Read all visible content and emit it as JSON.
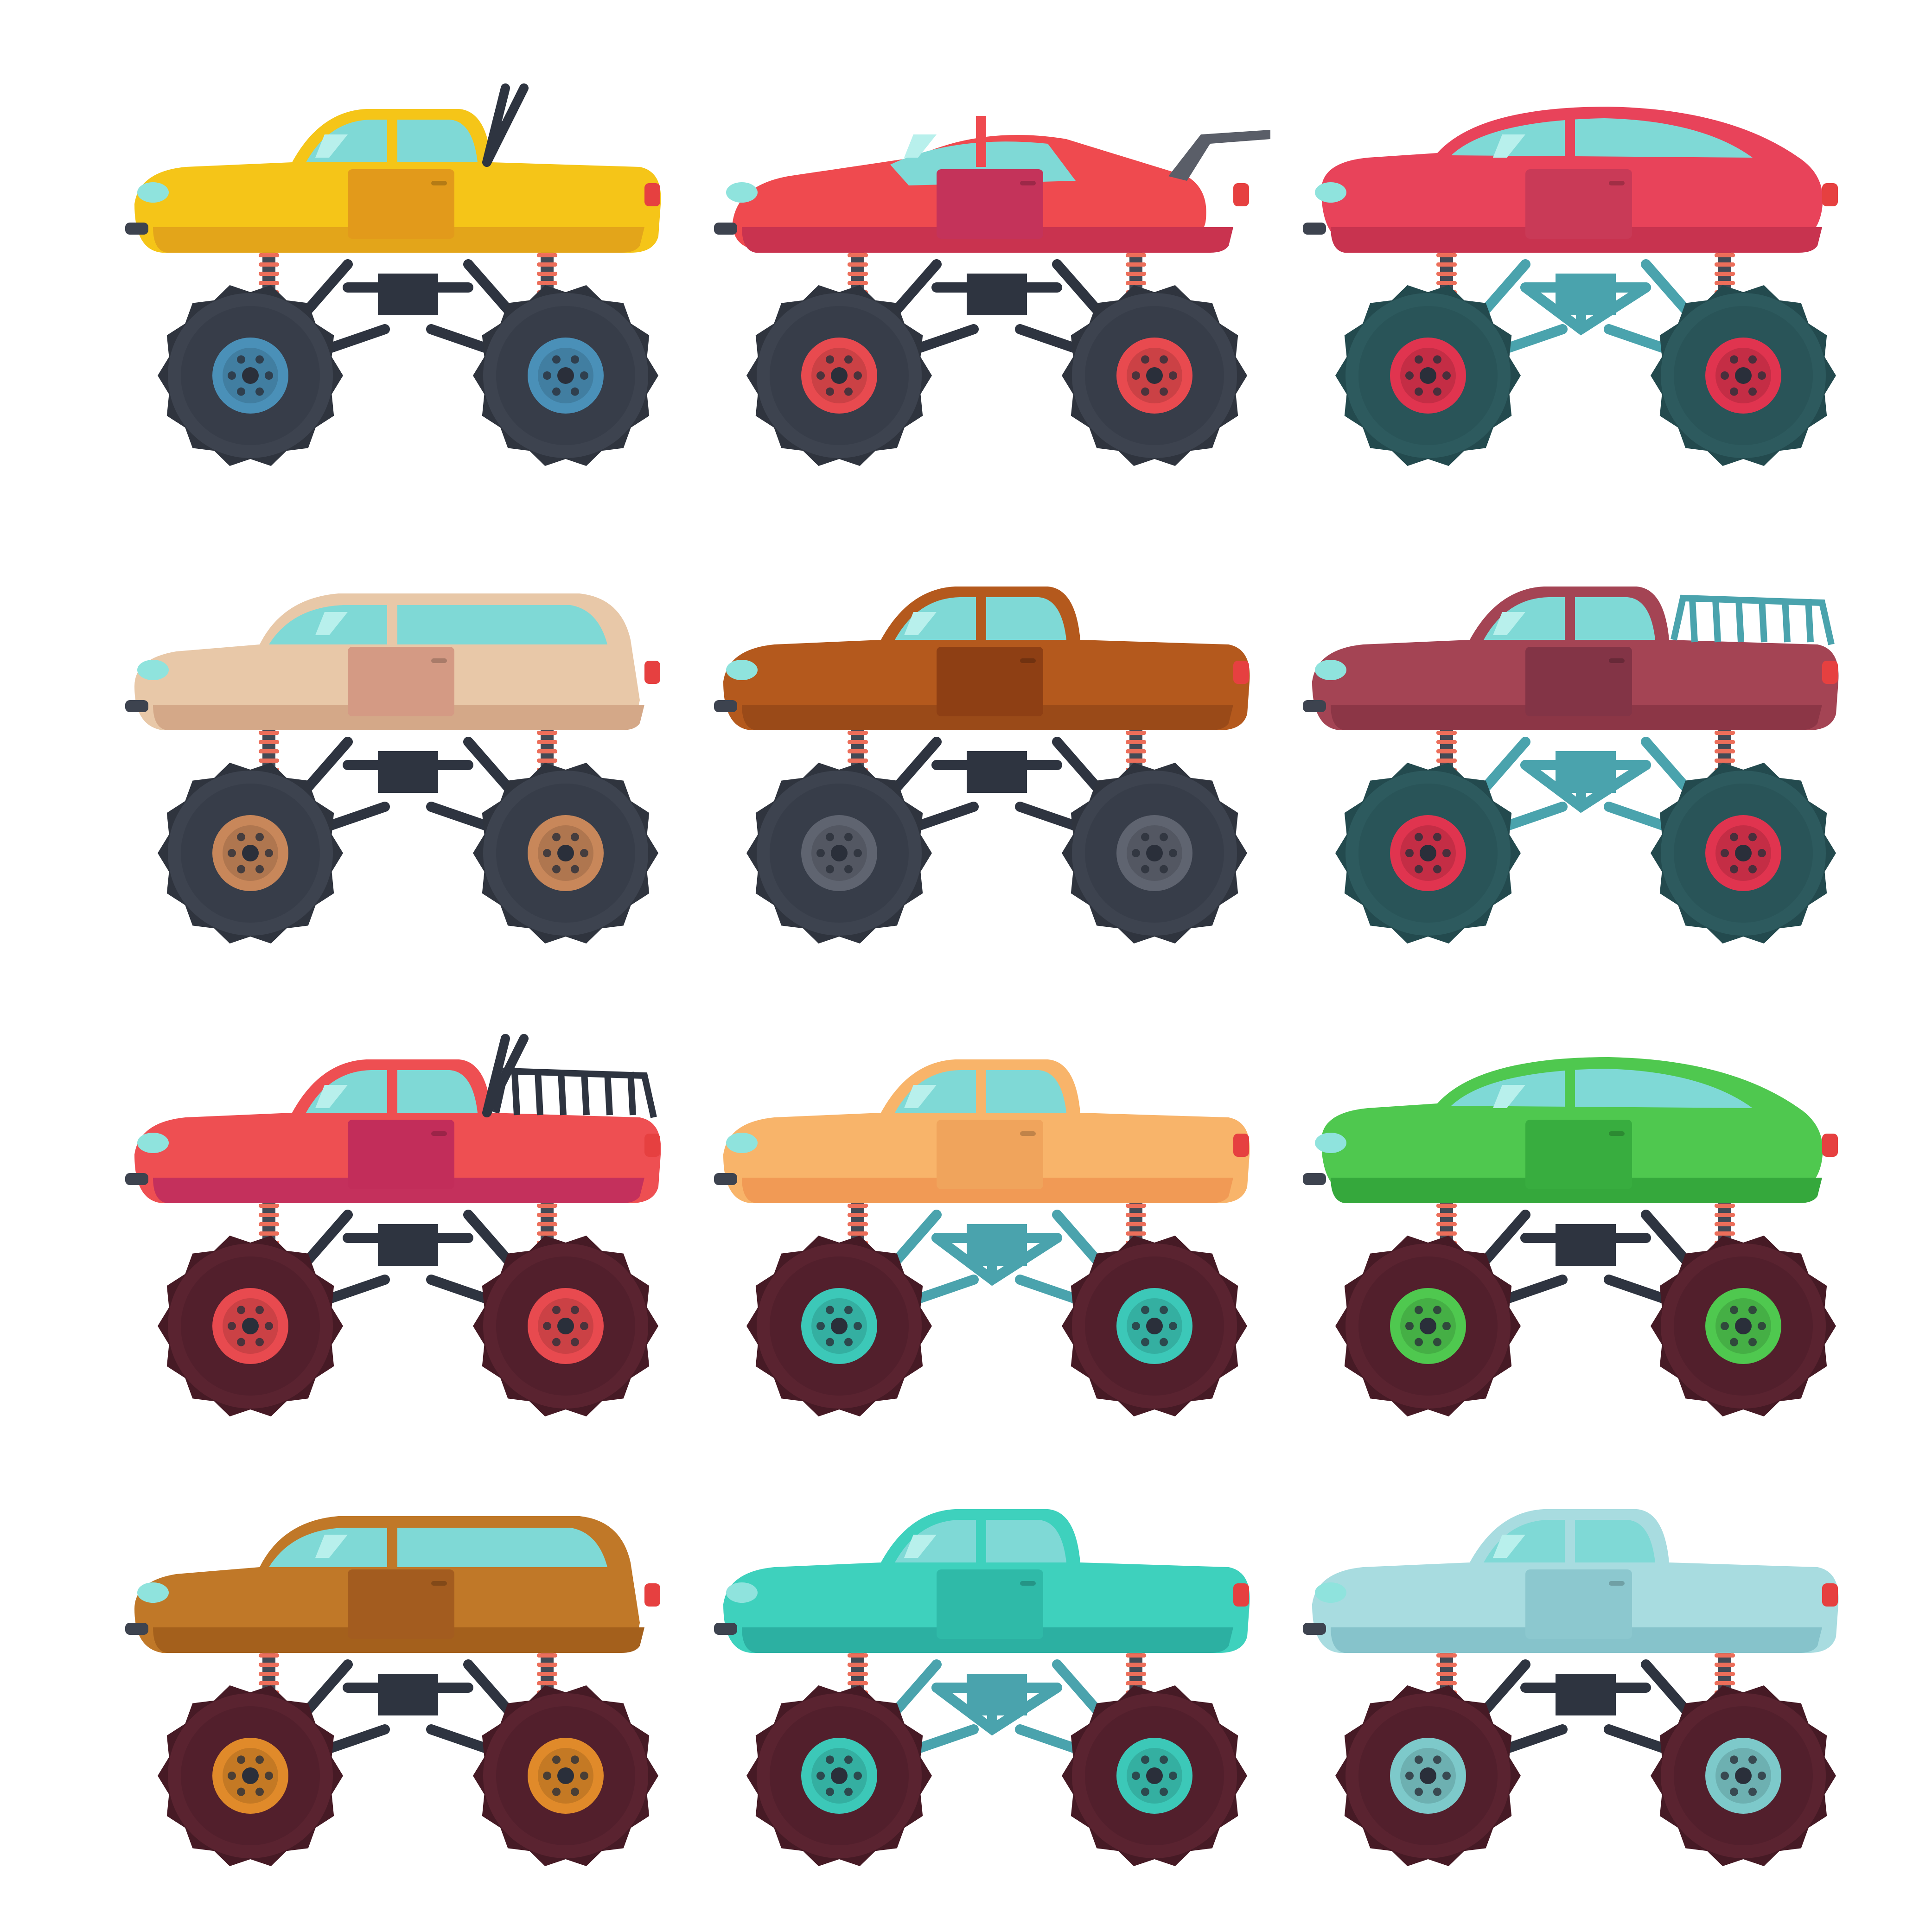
{
  "colors": {
    "background": "#ffffff",
    "dark_tire": "#3d434f",
    "dark_tire_tread": "#2f343e",
    "teal_tire": "#2d5a5e",
    "teal_tire_tread": "#234a4e",
    "maroon_tire": "#5a2330",
    "maroon_tire_tread": "#461a25",
    "frame_dark": "#2e3440",
    "frame_teal": "#4aa3ad",
    "window": "#7fd9d6",
    "window_shine": "#b8f0ec"
  },
  "trucks": [
    {
      "name": "yellow-pickup-monster-truck",
      "style": "pickup",
      "body": "#f5c518",
      "body_shade": "#e3a51a",
      "door": "#e29a1b",
      "wheel": "#4a90b8",
      "tire": "dark",
      "frame": "dark",
      "rollbar": true,
      "spoiler": false,
      "cage": false
    },
    {
      "name": "red-sports-monster-truck",
      "style": "sports",
      "body": "#ef4a4f",
      "body_shade": "#c9334f",
      "door": "#c4335a",
      "wheel": "#e84a4f",
      "tire": "dark",
      "frame": "dark",
      "rollbar": false,
      "spoiler": true,
      "cage": false
    },
    {
      "name": "pink-coupe-monster-truck",
      "style": "coupe",
      "body": "#e8435a",
      "body_shade": "#c8334f",
      "door": "#c93a57",
      "wheel": "#e0344f",
      "tire": "teal",
      "frame": "teal",
      "rollbar": false,
      "spoiler": false,
      "cage": false
    },
    {
      "name": "beige-suv-monster-truck",
      "style": "suv",
      "body": "#e8c8a8",
      "body_shade": "#d4a888",
      "door": "#d49a84",
      "wheel": "#c8875a",
      "tire": "dark",
      "frame": "dark",
      "rollbar": false,
      "spoiler": false,
      "cage": false
    },
    {
      "name": "brown-pickup-monster-truck",
      "style": "pickup",
      "body": "#b4591d",
      "body_shade": "#9a4a18",
      "door": "#8e3f14",
      "wheel": "#5f6470",
      "tire": "dark",
      "frame": "dark",
      "rollbar": false,
      "spoiler": false,
      "cage": false
    },
    {
      "name": "maroon-pickup-monster-truck",
      "style": "pickup",
      "body": "#a44454",
      "body_shade": "#8c3646",
      "door": "#833446",
      "wheel": "#e0344f",
      "tire": "teal",
      "frame": "teal",
      "rollbar": false,
      "spoiler": false,
      "cage": true
    },
    {
      "name": "red-rollcage-monster-truck",
      "style": "pickup",
      "body": "#ee4f52",
      "body_shade": "#c4305c",
      "door": "#c22d5a",
      "wheel": "#e84a4f",
      "tire": "maroon",
      "frame": "dark",
      "rollbar": true,
      "spoiler": false,
      "cage": true
    },
    {
      "name": "orange-pickup-monster-truck",
      "style": "pickup",
      "body": "#f8b46a",
      "body_shade": "#f19a55",
      "door": "#f0a45c",
      "wheel": "#3cc8b8",
      "tire": "maroon",
      "frame": "teal",
      "rollbar": false,
      "spoiler": false,
      "cage": false
    },
    {
      "name": "green-beetle-monster-truck",
      "style": "coupe",
      "body": "#4fc84f",
      "body_shade": "#35a83c",
      "door": "#38ad3f",
      "wheel": "#4fc84f",
      "tire": "maroon",
      "frame": "dark",
      "rollbar": false,
      "spoiler": false,
      "cage": false
    },
    {
      "name": "brown-suv-monster-truck",
      "style": "suv",
      "body": "#c07828",
      "body_shade": "#a4601c",
      "door": "#a35c1f",
      "wheel": "#e08a2a",
      "tire": "maroon",
      "frame": "dark",
      "rollbar": false,
      "spoiler": false,
      "cage": false
    },
    {
      "name": "teal-pickup-monster-truck",
      "style": "pickup",
      "body": "#3ed1bd",
      "body_shade": "#2cb0a2",
      "door": "#2fbaa8",
      "wheel": "#3cc8b8",
      "tire": "maroon",
      "frame": "teal",
      "rollbar": false,
      "spoiler": false,
      "cage": false
    },
    {
      "name": "lightblue-pickup-monster-truck",
      "style": "pickup",
      "body": "#a8dce0",
      "body_shade": "#86c3cb",
      "door": "#8cc8cf",
      "wheel": "#7dc9ca",
      "tire": "maroon",
      "frame": "dark",
      "rollbar": false,
      "spoiler": false,
      "cage": false
    }
  ]
}
